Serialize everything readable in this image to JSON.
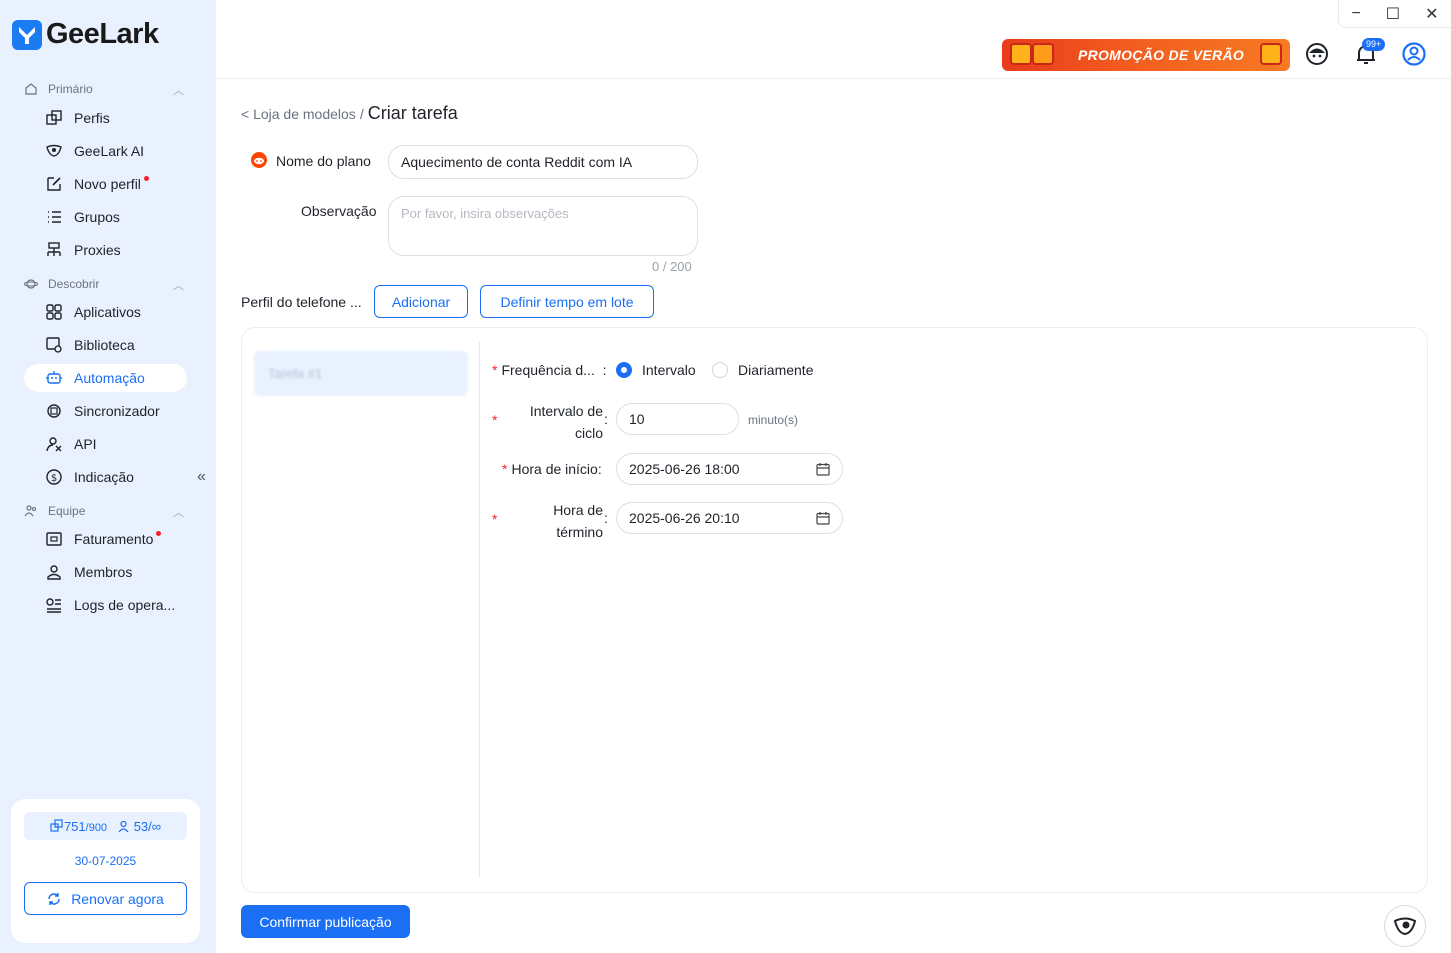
{
  "brand": {
    "name": "GeeLark",
    "accent": "#1a6ff5"
  },
  "sidebar": {
    "sections": [
      {
        "label": "Primário"
      },
      {
        "label": "Descobrir"
      },
      {
        "label": "Equipe"
      }
    ],
    "items": [
      {
        "label": "Perfis"
      },
      {
        "label": "GeeLark AI"
      },
      {
        "label": "Novo perfil"
      },
      {
        "label": "Grupos"
      },
      {
        "label": "Proxies"
      },
      {
        "label": "Aplicativos"
      },
      {
        "label": "Biblioteca"
      },
      {
        "label": "Automação"
      },
      {
        "label": "Sincronizador"
      },
      {
        "label": "API"
      },
      {
        "label": "Indicação"
      },
      {
        "label": "Faturamento"
      },
      {
        "label": "Membros"
      },
      {
        "label": "Logs de opera..."
      }
    ],
    "collapse_glyph": "«",
    "account": {
      "profiles_used": "751",
      "profiles_total": "/900",
      "members_used": "53",
      "members_total": "/∞",
      "expiry": "30-07-2025",
      "renew_label": "Renovar agora"
    }
  },
  "topbar": {
    "promo_label": "PROMOÇÃO DE VERÃO",
    "notification_badge": "99+",
    "window_controls": [
      "−",
      "☐",
      "✕"
    ]
  },
  "breadcrumb": {
    "parent": "< Loja de modelos",
    "separator": "/",
    "current": "Criar tarefa"
  },
  "form": {
    "plan_name_label": "Nome do plano",
    "plan_name_value": "Aquecimento de conta Reddit com IA",
    "note_label": "Observação",
    "note_placeholder": "Por favor, insira observações",
    "note_counter": "0 / 200",
    "phone_profile_label": "Perfil do telefone ...",
    "add_label": "Adicionar",
    "batch_time_label": "Definir tempo em lote",
    "task_tab_label": "Tarefa #1",
    "frequency_label": "Frequência d...",
    "frequency_options": [
      "Intervalo",
      "Diariamente"
    ],
    "frequency_selected": "Intervalo",
    "cycle_label_1": "Intervalo de",
    "cycle_label_2": "ciclo",
    "cycle_value": "10",
    "cycle_unit": "minuto(s)",
    "start_label": "Hora de início",
    "start_value": "2025-06-26 18:00",
    "end_label_1": "Hora de",
    "end_label_2": "término",
    "end_value": "2025-06-26 20:10",
    "colon": ":",
    "required_mark": "*"
  },
  "confirm_label": "Confirmar publicação"
}
